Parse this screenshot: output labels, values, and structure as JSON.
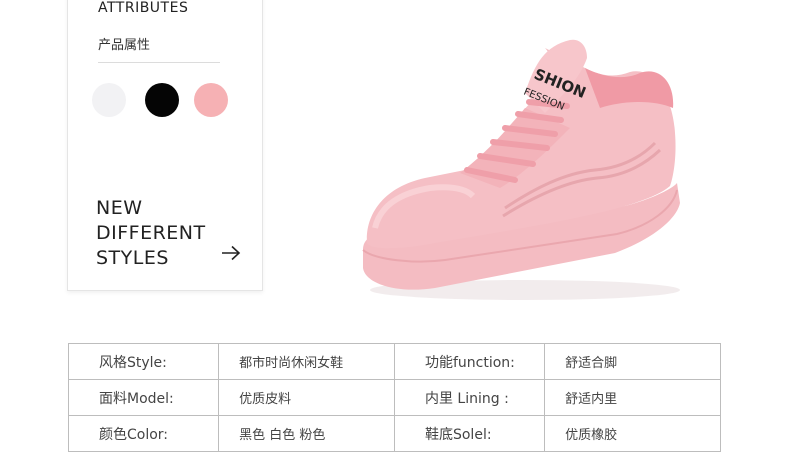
{
  "attributes": {
    "title_en": "ATTRIBUTES",
    "title_cn": "产品属性",
    "swatches": [
      {
        "name": "white",
        "color": "#f2f2f4"
      },
      {
        "name": "black",
        "color": "#050505"
      },
      {
        "name": "pink",
        "color": "#f6b1b4"
      }
    ]
  },
  "styles": {
    "line1": "NEW",
    "line2": "DIFFERENT",
    "line3": "STYLES"
  },
  "product_image": {
    "brand_text_top": "SHION",
    "brand_text_bottom": "FESSION",
    "main_color": "#f3b7bd"
  },
  "specs": [
    {
      "label_left": "风格Style:",
      "value_left": "都市时尚休闲女鞋",
      "label_right": "功能function:",
      "value_right": "舒适合脚"
    },
    {
      "label_left": "面料Model:",
      "value_left": "优质皮料",
      "label_right": "内里 Lining :",
      "value_right": "舒适内里"
    },
    {
      "label_left": "颜色Color:",
      "value_left": "黑色  白色  粉色",
      "label_right": "鞋底Solel:",
      "value_right": "优质橡胶"
    }
  ]
}
